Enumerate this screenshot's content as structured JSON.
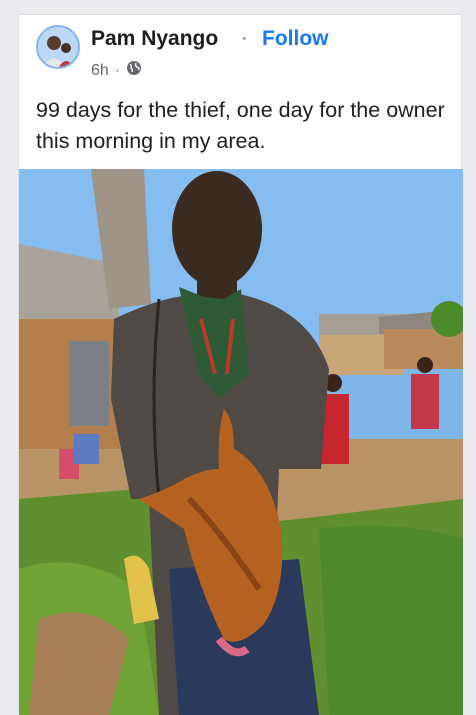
{
  "post": {
    "author": "Pam Nyango",
    "separator": "·",
    "follow_label": "Follow",
    "time": "6h",
    "meta_dot": "·",
    "privacy_icon": "globe-icon",
    "caption": "99 days for the thief, one day for the owner this morning in my area."
  },
  "colors": {
    "accent": "#1877f2",
    "text": "#1c1e21",
    "muted": "#65676b"
  }
}
